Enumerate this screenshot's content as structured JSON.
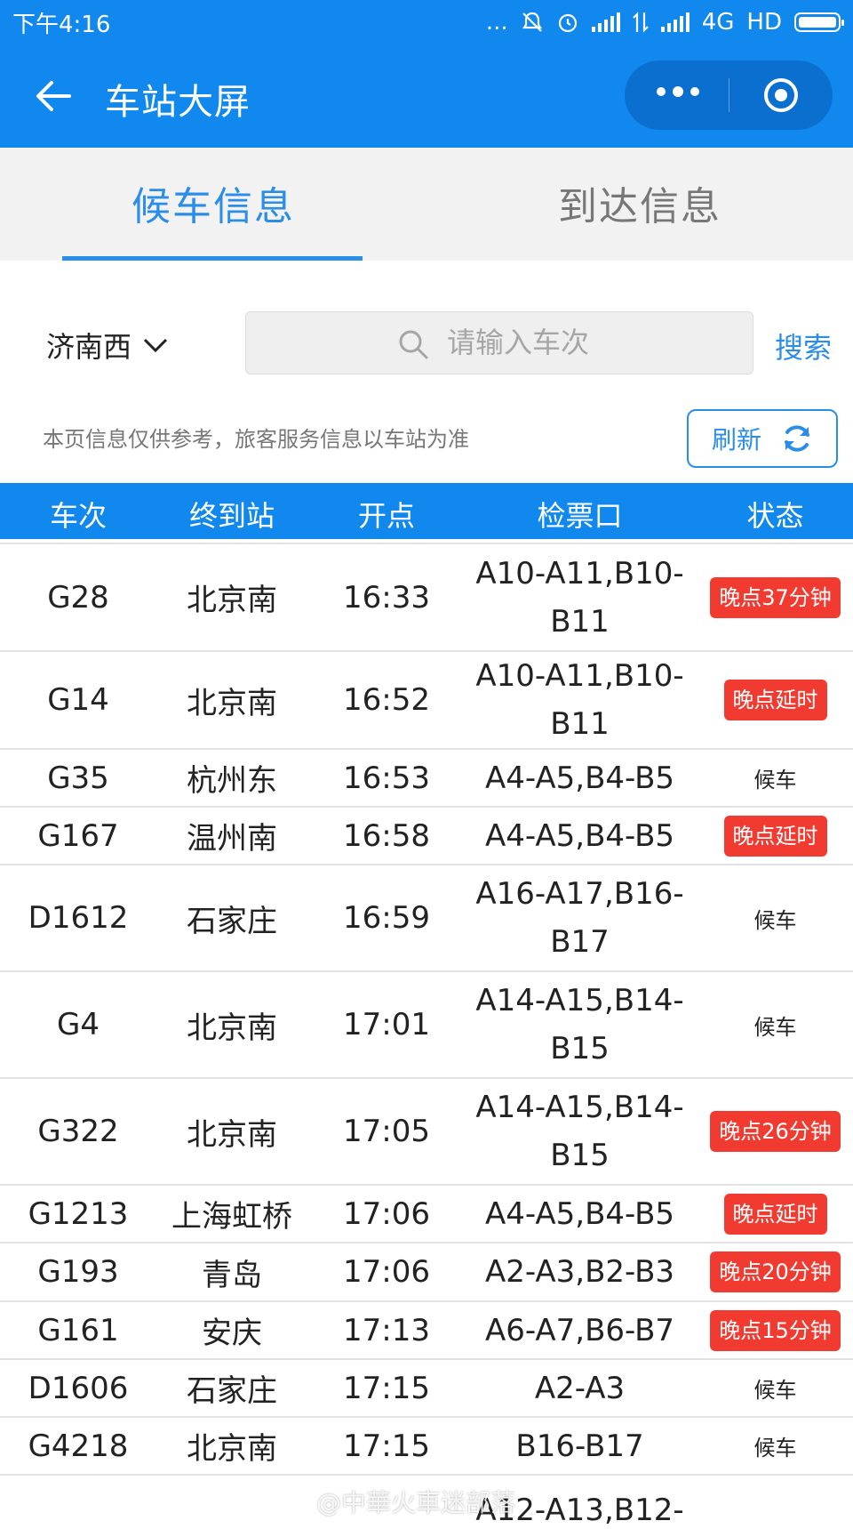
{
  "status_bar": {
    "time": "下午4:16",
    "dots": "...",
    "network": "4G",
    "hd": "HD"
  },
  "nav": {
    "title": "车站大屏"
  },
  "tabs": [
    {
      "label": "候车信息",
      "active": true
    },
    {
      "label": "到达信息",
      "active": false
    }
  ],
  "search": {
    "station": "济南西",
    "placeholder": "请输入车次",
    "button": "搜索"
  },
  "notice": "本页信息仅供参考，旅客服务信息以车站为准",
  "refresh_label": "刷新",
  "table": {
    "headers": {
      "train": "车次",
      "dest": "终到站",
      "time": "开点",
      "gate": "检票口",
      "status": "状态"
    },
    "rows": [
      {
        "train": "G28",
        "dest": "北京南",
        "time": "16:33",
        "gate": "A10-A11,B10-B11",
        "status": "晚点37分钟",
        "late": true
      },
      {
        "train": "G14",
        "dest": "北京南",
        "time": "16:52",
        "gate": "A10-A11,B10-B11",
        "status": "晚点延时",
        "late": true
      },
      {
        "train": "G35",
        "dest": "杭州东",
        "time": "16:53",
        "gate": "A4-A5,B4-B5",
        "status": "候车",
        "late": false
      },
      {
        "train": "G167",
        "dest": "温州南",
        "time": "16:58",
        "gate": "A4-A5,B4-B5",
        "status": "晚点延时",
        "late": true
      },
      {
        "train": "D1612",
        "dest": "石家庄",
        "time": "16:59",
        "gate": "A16-A17,B16-B17",
        "status": "候车",
        "late": false
      },
      {
        "train": "G4",
        "dest": "北京南",
        "time": "17:01",
        "gate": "A14-A15,B14-B15",
        "status": "候车",
        "late": false
      },
      {
        "train": "G322",
        "dest": "北京南",
        "time": "17:05",
        "gate": "A14-A15,B14-B15",
        "status": "晚点26分钟",
        "late": true
      },
      {
        "train": "G1213",
        "dest": "上海虹桥",
        "time": "17:06",
        "gate": "A4-A5,B4-B5",
        "status": "晚点延时",
        "late": true
      },
      {
        "train": "G193",
        "dest": "青岛",
        "time": "17:06",
        "gate": "A2-A3,B2-B3",
        "status": "晚点20分钟",
        "late": true
      },
      {
        "train": "G161",
        "dest": "安庆",
        "time": "17:13",
        "gate": "A6-A7,B6-B7",
        "status": "晚点15分钟",
        "late": true
      },
      {
        "train": "D1606",
        "dest": "石家庄",
        "time": "17:15",
        "gate": "A2-A3",
        "status": "候车",
        "late": false
      },
      {
        "train": "G4218",
        "dest": "北京南",
        "time": "17:15",
        "gate": "B16-B17",
        "status": "候车",
        "late": false
      },
      {
        "train": "",
        "dest": "",
        "time": "",
        "gate": "A12-A13,B12-",
        "status": "",
        "late": false
      }
    ]
  },
  "watermark": "@中華火車迷部落",
  "colors": {
    "primary": "#1188ee",
    "accent": "#2a8de8",
    "late": "#f23b30"
  }
}
